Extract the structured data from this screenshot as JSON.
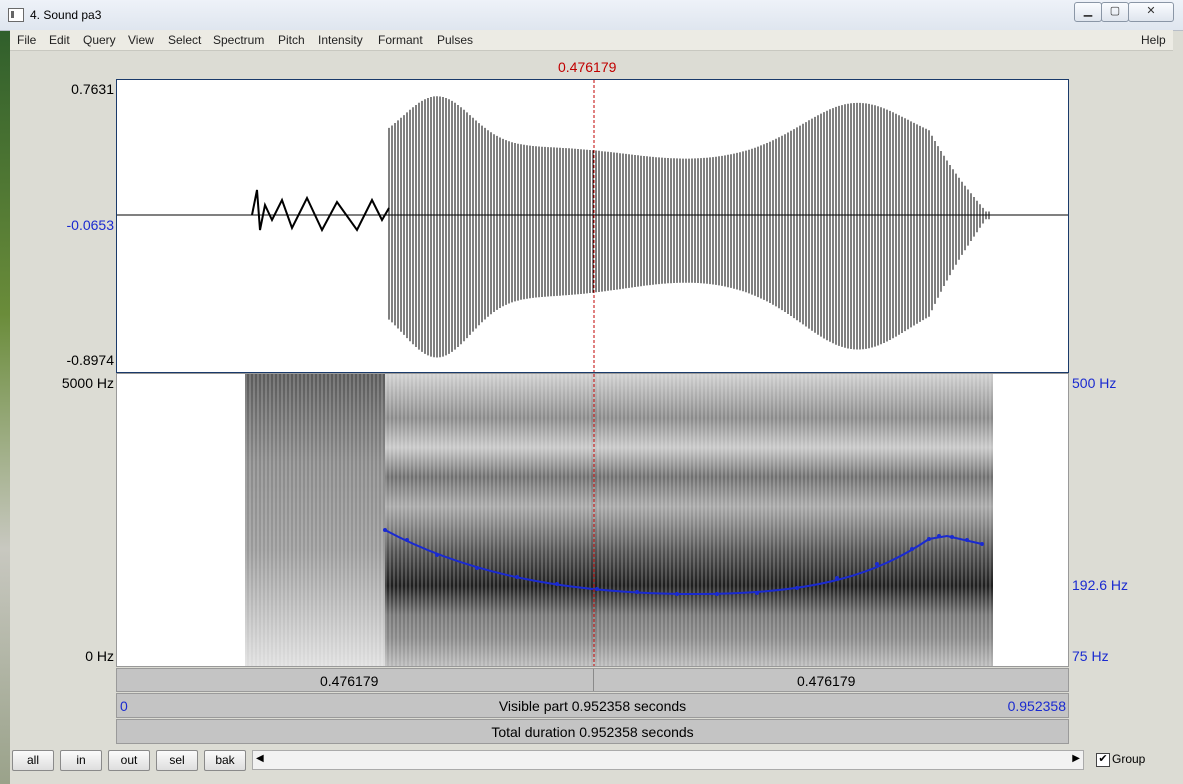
{
  "window": {
    "title": "4. Sound pa3"
  },
  "menu": [
    "File",
    "Edit",
    "Query",
    "View",
    "Select",
    "Spectrum",
    "Pitch",
    "Intensity",
    "Formant",
    "Pulses"
  ],
  "help": "Help",
  "cursor_time": "0.476179",
  "waveform": {
    "max": "0.7631",
    "mid": "-0.0653",
    "min": "-0.8974"
  },
  "spectrogram": {
    "top_left": "5000 Hz",
    "bottom_left": "0 Hz"
  },
  "pitch": {
    "top": "500 Hz",
    "value": "192.6 Hz",
    "bottom": "75 Hz"
  },
  "time_bar": {
    "left": "0.476179",
    "right": "0.476179"
  },
  "visible_bar": {
    "start": "0",
    "label": "Visible part 0.952358 seconds",
    "end": "0.952358"
  },
  "total_bar": {
    "label": "Total duration 0.952358 seconds"
  },
  "buttons": {
    "all": "all",
    "in": "in",
    "out": "out",
    "sel": "sel",
    "bak": "bak"
  },
  "group_label": "Group",
  "group_checked": true,
  "colors": {
    "cursor": "#c00000",
    "pitch": "#1a2ad0",
    "axis_blue": "#1a2ad0"
  },
  "icons": {
    "scroll_left": "scroll-left-icon",
    "scroll_right": "scroll-right-icon"
  }
}
